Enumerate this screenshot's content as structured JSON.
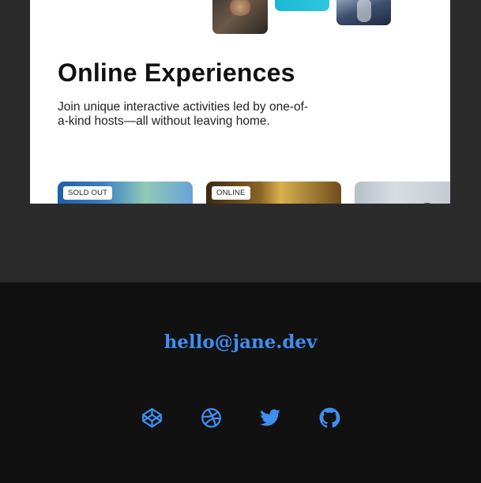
{
  "experiences": {
    "title": "Online Experiences",
    "description": "Join unique interactive activities led by one-of-a-kind hosts—all without leaving home.",
    "cards": [
      {
        "badge": "SOLD OUT"
      },
      {
        "badge": "ONLINE"
      },
      {
        "badge": ""
      }
    ]
  },
  "footer": {
    "email": "hello@jane.dev",
    "social": [
      {
        "icon": "codepen-icon"
      },
      {
        "icon": "dribbble-icon"
      },
      {
        "icon": "twitter-icon"
      },
      {
        "icon": "github-icon"
      }
    ]
  },
  "colors": {
    "page_background": "#2b2b2b",
    "footer_background": "#111111",
    "accent": "#3f8ef0",
    "card_background": "#ffffff"
  }
}
